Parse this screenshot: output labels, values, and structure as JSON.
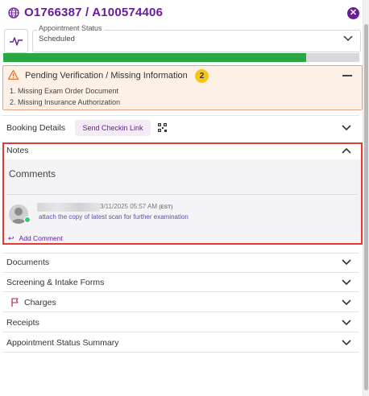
{
  "header": {
    "title": "O1766387 / A100574406",
    "close_icon": "close-icon",
    "globe_icon": "globe-icon"
  },
  "status": {
    "label": "Appointment Status",
    "value": "Scheduled",
    "icon": "activity-icon",
    "progress_fraction": 0.85,
    "progress_color": "#28a745"
  },
  "alert": {
    "title": "Pending Verification / Missing Information",
    "count": "2",
    "items": [
      "1. Missing Exam Order Document",
      "2. Missing Insurance Authorization"
    ],
    "accent": "#e9a577"
  },
  "sections": {
    "booking": {
      "label": "Booking Details",
      "checkin_label": "Send Checkin Link"
    },
    "notes": {
      "label": "Notes"
    },
    "documents": {
      "label": "Documents"
    },
    "screening": {
      "label": "Screening & Intake Forms"
    },
    "charges": {
      "label": "Charges"
    },
    "receipts": {
      "label": "Receipts"
    },
    "status_summary": {
      "label": "Appointment Status Summary"
    }
  },
  "comments": {
    "title": "Comments",
    "entry": {
      "timestamp": "3/11/2025 05:57 AM",
      "timezone": "(EST)",
      "text": "attach the copy of latest scan for further examination"
    },
    "add_label": "Add Comment"
  },
  "colors": {
    "brand": "#6a1b9a",
    "highlight": "#e53935"
  }
}
